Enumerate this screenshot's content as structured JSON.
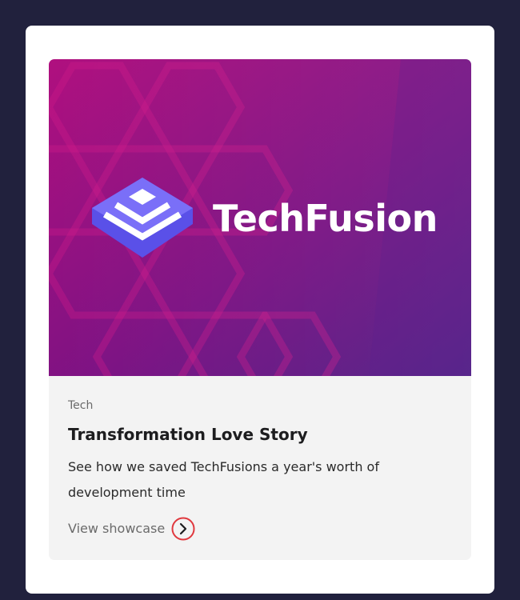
{
  "hero": {
    "brand_name": "TechFusion",
    "logo_icon": "stacked-layers-icon",
    "colors": {
      "gradient_start": "#b0107f",
      "gradient_end": "#4f1a85",
      "logo_primary": "#6a5cf6"
    }
  },
  "card": {
    "category": "Tech",
    "title": "Transformation Love Story",
    "description": "See how we saved TechFusions a year's worth of development time",
    "cta_label": "View showcase",
    "cta_icon": "chevron-right-circle-icon",
    "accent_color": "#e0383e"
  }
}
